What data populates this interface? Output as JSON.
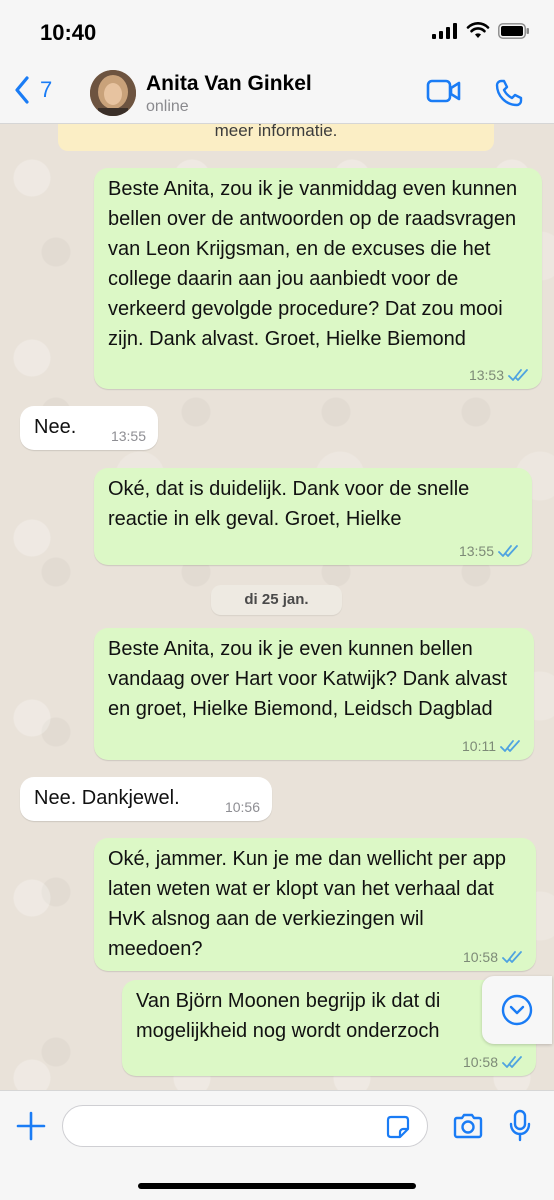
{
  "status_bar": {
    "time": "10:40"
  },
  "header": {
    "back_count": "7",
    "contact_name": "Anita Van Ginkel",
    "contact_status": "online"
  },
  "info_banner": "meer informatie.",
  "messages": [
    {
      "direction": "out",
      "text": "Beste Anita, zou ik je vanmiddag even kunnen bellen over de antwoorden op de raadsvragen van Leon Krijgsman, en de excuses die het college daarin aan jou aanbiedt voor de verkeerd gevolgde procedure? Dat zou mooi zijn. Dank alvast. Groet, Hielke Biemond",
      "time": "13:53",
      "status": "read"
    },
    {
      "direction": "in",
      "text": "Nee.",
      "time": "13:55"
    },
    {
      "direction": "out",
      "text": "Oké, dat is duidelijk. Dank voor de snelle reactie in elk geval. Groet, Hielke",
      "time": "13:55",
      "status": "read"
    },
    {
      "direction": "out",
      "text": "Beste Anita, zou ik je even kunnen bellen vandaag over Hart voor Katwijk? Dank alvast en groet, Hielke Biemond, Leidsch Dagblad",
      "time": "10:11",
      "status": "read"
    },
    {
      "direction": "in",
      "text": "Nee. Dankjewel.",
      "time": "10:56"
    },
    {
      "direction": "out",
      "text": "Oké, jammer. Kun je me dan wellicht per app laten weten wat er klopt van het verhaal dat HvK alsnog aan de verkiezingen wil meedoen?",
      "time": "10:58",
      "status": "read"
    },
    {
      "direction": "out",
      "text": "Van Björn Moonen begrijp ik dat di mogelijkheid nog wordt onderzoch",
      "time": "10:58",
      "status": "read"
    }
  ],
  "date_separator": "di 25 jan.",
  "input": {
    "placeholder": ""
  },
  "colors": {
    "accent": "#1a7cf5",
    "outgoing_bubble": "#dcf8c6",
    "incoming_bubble": "#ffffff",
    "chat_background": "#e9e2d9",
    "banner": "#fbeec5",
    "read_ticks": "#4fa3e0"
  },
  "icons": {
    "back": "chevron-left-icon",
    "video": "video-camera-icon",
    "call": "phone-icon",
    "scroll_down": "chevron-down-circle-icon",
    "attach": "plus-icon",
    "sticker": "sticker-icon",
    "camera": "camera-icon",
    "mic": "microphone-icon"
  }
}
